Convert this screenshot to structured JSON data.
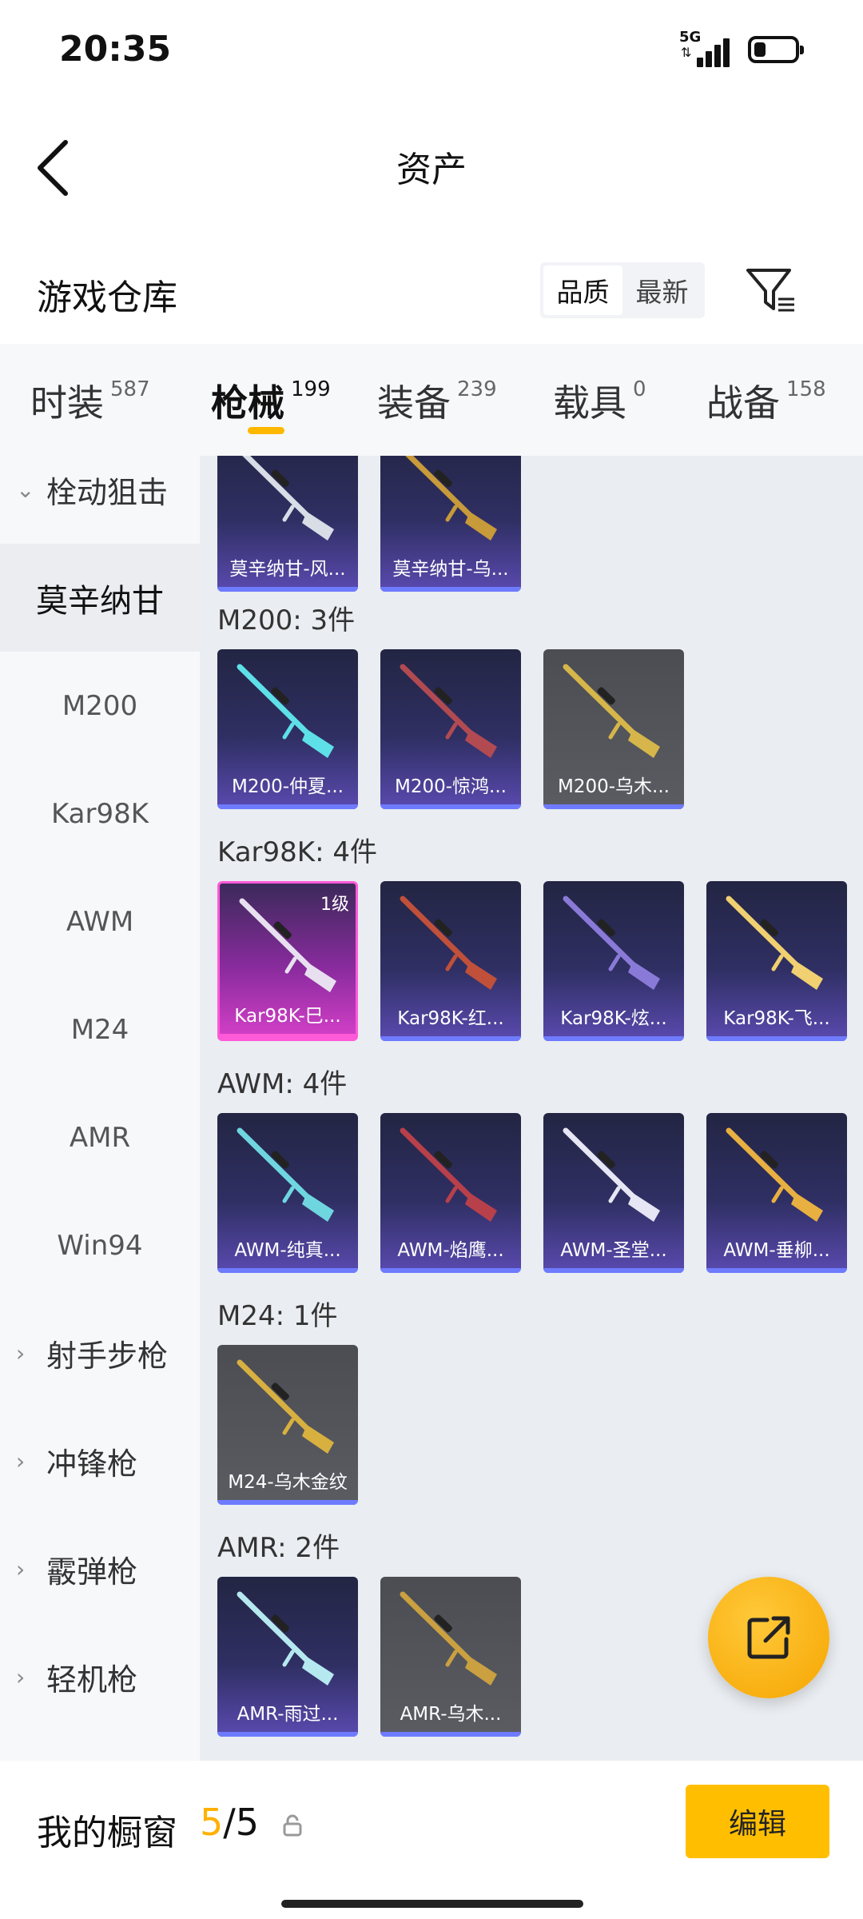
{
  "status_bar": {
    "time": "20:35",
    "network": "5G",
    "battery_level": 0.3
  },
  "header": {
    "title": "资产"
  },
  "warehouse": {
    "title": "游戏仓库",
    "sort_options": [
      {
        "label": "品质",
        "active": true
      },
      {
        "label": "最新",
        "active": false
      }
    ]
  },
  "category_tabs": [
    {
      "label": "时装",
      "count": "587",
      "active": false
    },
    {
      "label": "枪械",
      "count": "199",
      "active": true
    },
    {
      "label": "装备",
      "count": "239",
      "active": false
    },
    {
      "label": "载具",
      "count": "0",
      "active": false
    },
    {
      "label": "战备",
      "count": "158",
      "active": false
    }
  ],
  "sidebar": {
    "items": [
      {
        "label": "栓动狙击",
        "type": "group",
        "expanded": true
      },
      {
        "label": "莫辛纳甘",
        "type": "item",
        "active": true
      },
      {
        "label": "M200",
        "type": "item"
      },
      {
        "label": "Kar98K",
        "type": "item"
      },
      {
        "label": "AWM",
        "type": "item"
      },
      {
        "label": "M24",
        "type": "item"
      },
      {
        "label": "AMR",
        "type": "item"
      },
      {
        "label": "Win94",
        "type": "item"
      },
      {
        "label": "射手步枪",
        "type": "group"
      },
      {
        "label": "冲锋枪",
        "type": "group"
      },
      {
        "label": "霰弹枪",
        "type": "group"
      },
      {
        "label": "轻机枪",
        "type": "group"
      }
    ]
  },
  "groups": [
    {
      "title": "",
      "items": [
        {
          "name": "莫辛纳甘-风...",
          "style": "purple"
        },
        {
          "name": "莫辛纳甘-乌...",
          "style": "purple"
        }
      ]
    },
    {
      "title": "M200: 3件",
      "items": [
        {
          "name": "M200-仲夏...",
          "style": "purple"
        },
        {
          "name": "M200-惊鸿...",
          "style": "purple"
        },
        {
          "name": "M200-乌木...",
          "style": "grey"
        }
      ]
    },
    {
      "title": "Kar98K: 4件",
      "items": [
        {
          "name": "Kar98K-巳...",
          "style": "pink",
          "level": "1级"
        },
        {
          "name": "Kar98K-红...",
          "style": "purple"
        },
        {
          "name": "Kar98K-炫...",
          "style": "purple"
        },
        {
          "name": "Kar98K-飞...",
          "style": "purple"
        }
      ]
    },
    {
      "title": "AWM: 4件",
      "items": [
        {
          "name": "AWM-纯真...",
          "style": "purple"
        },
        {
          "name": "AWM-焰鹰...",
          "style": "purple"
        },
        {
          "name": "AWM-圣堂...",
          "style": "purple"
        },
        {
          "name": "AWM-垂柳...",
          "style": "purple"
        }
      ]
    },
    {
      "title": "M24: 1件",
      "items": [
        {
          "name": "M24-乌木金纹",
          "style": "grey"
        }
      ]
    },
    {
      "title": "AMR: 2件",
      "items": [
        {
          "name": "AMR-雨过...",
          "style": "purple"
        },
        {
          "name": "AMR-乌木...",
          "style": "grey"
        }
      ]
    }
  ],
  "showcase": {
    "label": "我的橱窗",
    "current": "5",
    "separator": "/",
    "total": "5"
  },
  "edit_label": "编辑",
  "colors": {
    "accent": "#ffb800",
    "content_bg": "#eaedf1",
    "sidebar_bg": "#f7f8fa"
  }
}
